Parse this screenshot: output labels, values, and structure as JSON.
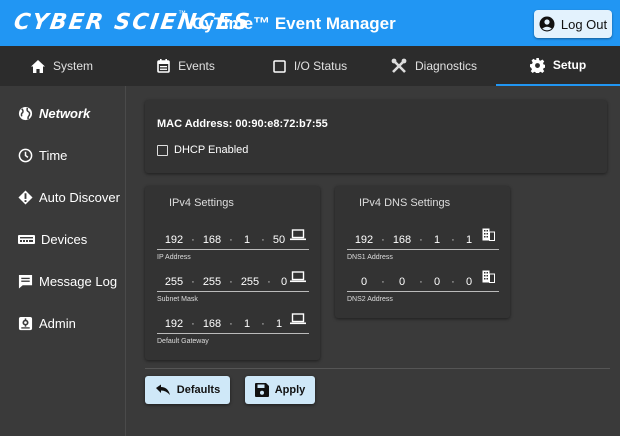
{
  "header": {
    "logo": "CYBER SCIENCES",
    "logo_mark": "™",
    "title": "CyTime™ Event Manager",
    "logout_label": "Log Out"
  },
  "tabs": [
    {
      "label": "System",
      "icon": "home-icon"
    },
    {
      "label": "Events",
      "icon": "calendar-icon"
    },
    {
      "label": "I/O Status",
      "icon": "checkbox-icon"
    },
    {
      "label": "Diagnostics",
      "icon": "tools-icon"
    },
    {
      "label": "Setup",
      "icon": "gear-icon",
      "active": true
    }
  ],
  "sidebar": {
    "items": [
      {
        "label": "Network",
        "icon": "globe-icon",
        "active": true
      },
      {
        "label": "Time",
        "icon": "clock-icon"
      },
      {
        "label": "Auto Discover",
        "icon": "discover-icon"
      },
      {
        "label": "Devices",
        "icon": "devices-icon"
      },
      {
        "label": "Message Log",
        "icon": "message-icon"
      },
      {
        "label": "Admin",
        "icon": "admin-icon"
      }
    ]
  },
  "network": {
    "mac_address": "MAC Address: 00:90:e8:72:b7:55",
    "dhcp_label": "DHCP Enabled",
    "dhcp_checked": false
  },
  "ipv4": {
    "title": "IPv4 Settings",
    "ip_address": {
      "octets": [
        "192",
        "168",
        "1",
        "50"
      ],
      "label": "IP Address"
    },
    "subnet_mask": {
      "octets": [
        "255",
        "255",
        "255",
        "0"
      ],
      "label": "Subnet Mask"
    },
    "default_gateway": {
      "octets": [
        "192",
        "168",
        "1",
        "1"
      ],
      "label": "Default Gateway"
    }
  },
  "dns": {
    "title": "IPv4 DNS Settings",
    "dns1": {
      "octets": [
        "192",
        "168",
        "1",
        "1"
      ],
      "label": "DNS1 Address"
    },
    "dns2": {
      "octets": [
        "0",
        "0",
        "0",
        "0"
      ],
      "label": "DNS2 Address"
    }
  },
  "buttons": {
    "defaults_label": "Defaults",
    "apply_label": "Apply"
  },
  "colors": {
    "header_bg": "#2196f3",
    "tabbar_bg": "#2c2c2c",
    "page_bg": "#3a3a3a",
    "card_bg": "#333333",
    "button_bg": "#cfe8f8",
    "accent": "#2196f3"
  }
}
